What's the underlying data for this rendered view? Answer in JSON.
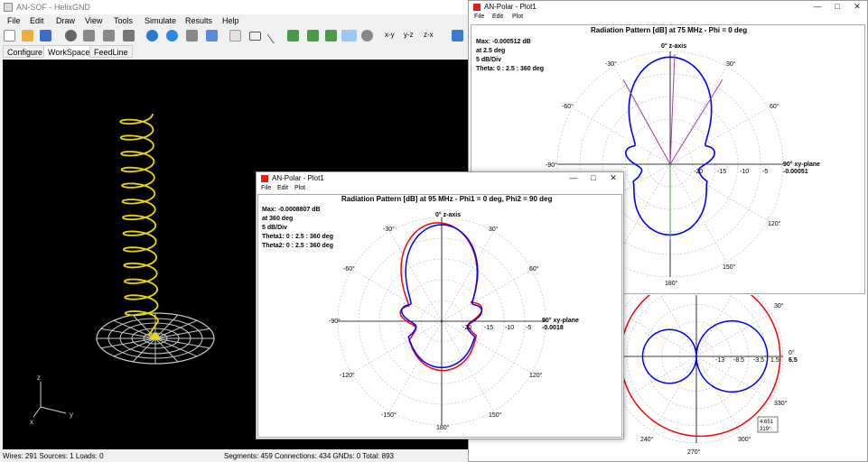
{
  "main_window": {
    "title": "AN-SOF - HelixGND",
    "menu": [
      "File",
      "Edit",
      "Draw",
      "View",
      "Tools",
      "Simulate",
      "Results",
      "Help"
    ],
    "tabs": [
      "Configure",
      "WorkSpace",
      "FeedLine"
    ],
    "toolbar_labels": [
      "x-y",
      "y-z",
      "z-x"
    ],
    "axes_labels": {
      "x": "x",
      "y": "y",
      "z": "z"
    }
  },
  "status_bar": {
    "left": "Wires: 291  Sources: 1  Loads: 0",
    "right": "Segments: 459  Connections: 434  GNDs: 0  Total: 893"
  },
  "polar_back": {
    "title": "AN-Polar - Plot1",
    "menu": [
      "File",
      "Edit",
      "Plot"
    ],
    "plot_title": "Radiation Pattern [dB] at 75 MHz - Phi = 0 deg",
    "info": [
      "Max: -0.000512 dB",
      "at 2.5 deg",
      "5 dB/Div",
      "Theta: 0 : 2.5 : 360 deg"
    ],
    "axis_top": "0°  z-axis",
    "axis_right": "90°  xy-plane",
    "right_value": "-0.00051",
    "angle_labels": {
      "m30": "-30°",
      "p30": "30°",
      "m60": "-60°",
      "p60": "60°",
      "m90": "-90°",
      "p120": "120°",
      "p150": "150°",
      "p180": "180°"
    },
    "ring_labels": [
      "-20",
      "-15",
      "-10",
      "-5"
    ]
  },
  "polar_bottom": {
    "angle_labels": {
      "a30": "30°",
      "a0": "0°",
      "a330": "330°",
      "a300": "300°",
      "a270": "270°",
      "a240": "240°"
    },
    "right_value": "6.5",
    "ring_labels": [
      "-13",
      "-8.5",
      "-3.5",
      "1.5"
    ],
    "tooltip": [
      "4.651",
      "319°"
    ]
  },
  "polar_front": {
    "title": "AN-Polar - Plot1",
    "menu": [
      "File",
      "Edit",
      "Plot"
    ],
    "plot_title": "Radiation Pattern [dB] at 95 MHz - Phi1 = 0 deg, Phi2 = 90 deg",
    "info": [
      "Max: -0.0008807 dB",
      "at 360 deg",
      "5 dB/Div",
      "Theta1: 0 : 2.5 : 360 deg",
      "Theta2: 0 : 2.5 : 360 deg"
    ],
    "axis_top": "0°  z-axis",
    "axis_right": "90°  xy-plane",
    "right_value": "-0.0018",
    "angle_labels": {
      "m30": "-30°",
      "p30": "30°",
      "m60": "-60°",
      "p60": "60°",
      "m90": "-90°",
      "m120": "-120°",
      "p120": "120°",
      "m150": "-150°",
      "p150": "150°",
      "p180": "180°"
    },
    "ring_labels": [
      "-20",
      "-15",
      "-10",
      "-5"
    ]
  },
  "colors": {
    "pattern_1": "#0000ff",
    "pattern_2": "#ff0000",
    "helix": "#e8d800",
    "ground": "#c8c8c8",
    "workspace_bg": "#000000"
  },
  "icons": [
    "new-icon",
    "open-icon",
    "save-icon",
    "record-icon",
    "pencil-icon",
    "bucket-icon",
    "delete-icon",
    "rotate-icon",
    "sphere-icon",
    "comment-icon",
    "doc-icon",
    "cursor-icon",
    "rect-icon",
    "line-icon",
    "fx-icon",
    "fy-icon",
    "fz-icon",
    "diamond-icon",
    "zoom-icon",
    "grid-icon"
  ]
}
